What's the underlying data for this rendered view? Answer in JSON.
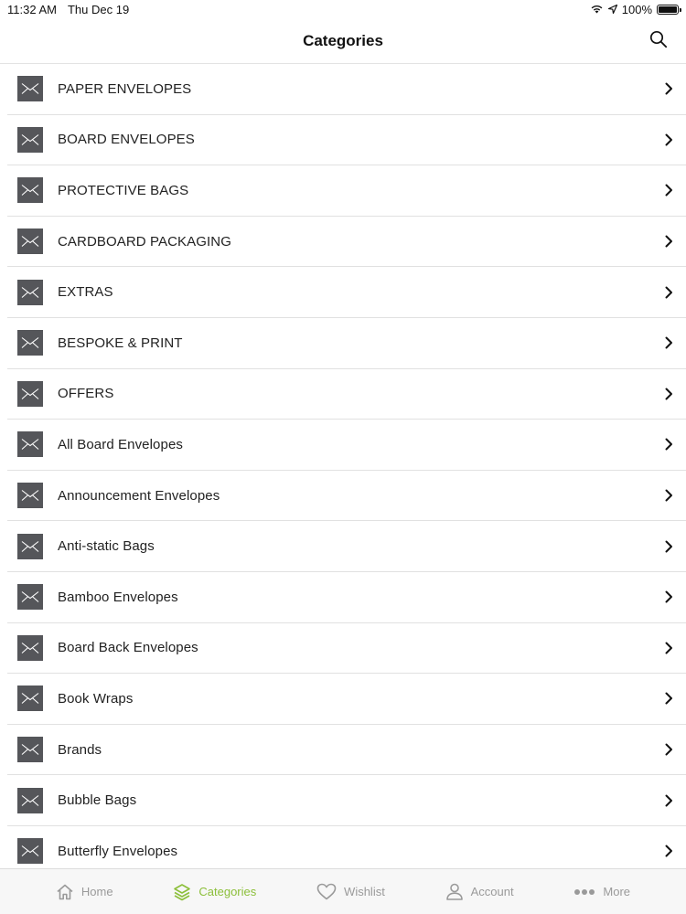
{
  "status_bar": {
    "time": "11:32 AM",
    "date": "Thu Dec 19",
    "battery": "100%"
  },
  "nav": {
    "title": "Categories",
    "search_icon": "search-icon"
  },
  "categories": [
    {
      "label": "PAPER ENVELOPES"
    },
    {
      "label": "BOARD ENVELOPES"
    },
    {
      "label": "PROTECTIVE BAGS"
    },
    {
      "label": "CARDBOARD PACKAGING"
    },
    {
      "label": "EXTRAS"
    },
    {
      "label": "BESPOKE & PRINT"
    },
    {
      "label": "OFFERS"
    },
    {
      "label": "All Board Envelopes"
    },
    {
      "label": "Announcement Envelopes"
    },
    {
      "label": "Anti-static Bags"
    },
    {
      "label": "Bamboo Envelopes"
    },
    {
      "label": "Board Back Envelopes"
    },
    {
      "label": "Book Wraps"
    },
    {
      "label": "Brands"
    },
    {
      "label": "Bubble Bags"
    },
    {
      "label": "Butterfly Envelopes"
    }
  ],
  "tabs": [
    {
      "label": "Home",
      "icon": "home-icon",
      "active": false
    },
    {
      "label": "Categories",
      "icon": "layers-icon",
      "active": true
    },
    {
      "label": "Wishlist",
      "icon": "heart-icon",
      "active": false
    },
    {
      "label": "Account",
      "icon": "user-icon",
      "active": false
    },
    {
      "label": "More",
      "icon": "more-dots-icon",
      "active": false
    }
  ],
  "colors": {
    "accent": "#8cbf3a",
    "tab_inactive": "#9a9a9a",
    "thumb_bg": "#55565a"
  }
}
